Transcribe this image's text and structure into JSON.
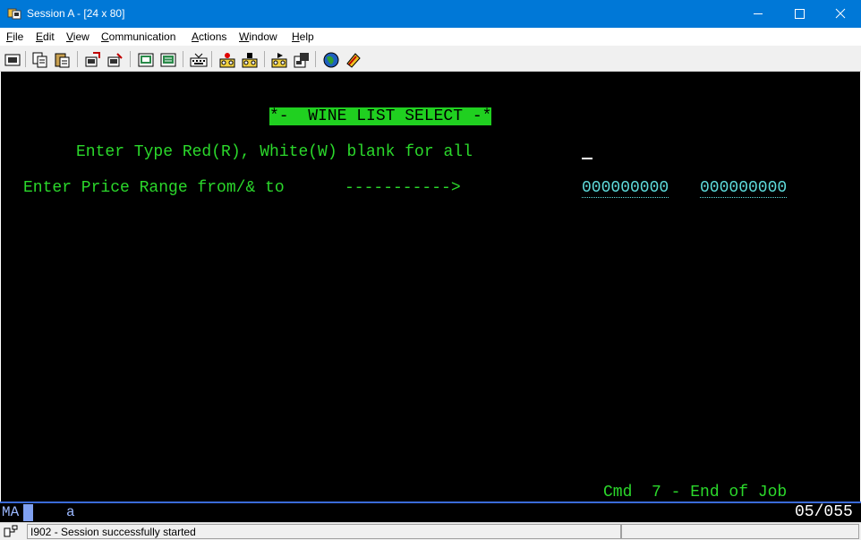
{
  "window": {
    "title": "Session A - [24 x 80]",
    "controls": {
      "minimize": "—",
      "maximize": "☐",
      "close": "✕"
    }
  },
  "menu": {
    "items": [
      {
        "first": "F",
        "rest": "ile"
      },
      {
        "first": "E",
        "rest": "dit"
      },
      {
        "first": "V",
        "rest": "iew"
      },
      {
        "first": "C",
        "rest": "ommunication"
      },
      {
        "first": "A",
        "rest": "ctions"
      },
      {
        "first": "W",
        "rest": "indow"
      },
      {
        "first": "H",
        "rest": "elp"
      }
    ]
  },
  "toolbar": {
    "buttons": [
      "print-screen-icon",
      "copy-icon",
      "paste-icon",
      "send-file-icon",
      "receive-file-icon",
      "display-keypad-icon",
      "record-macro-icon",
      "keyboard-icon",
      "stop-macro-icon",
      "play-macro-icon",
      "macro-icon",
      "macro-edit-icon",
      "globe-icon",
      "support-icon"
    ]
  },
  "terminal": {
    "screen_title": "*-  WINE LIST SELECT -*",
    "type_prompt": "Enter Type Red(R), White(W) blank for all",
    "price_prompt": "Enter Price Range from/& to",
    "price_arrow": "----------->",
    "price_from": "000000000",
    "price_to": "000000000",
    "footer": "Cmd  7 - End of Job"
  },
  "oia": {
    "mode": "MA",
    "indicator": "a",
    "cursor_position": "05/055"
  },
  "status": {
    "message": "I902 - Session successfully started"
  },
  "colors": {
    "title_bar": "#0078d7",
    "terminal_bg": "#000000",
    "green_text": "#2bd82b",
    "cyan_field": "#5fdcdc",
    "title_highlight": "#20d020"
  }
}
